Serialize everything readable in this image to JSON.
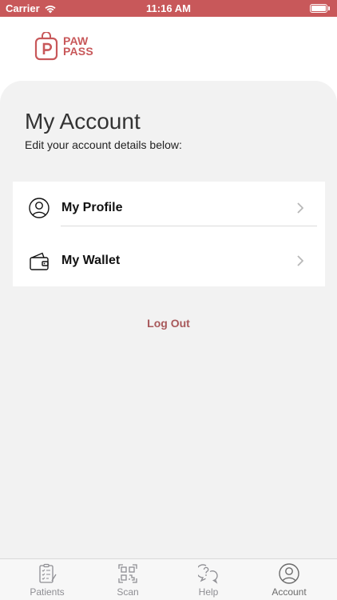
{
  "status_bar": {
    "carrier": "Carrier",
    "time": "11:16 AM"
  },
  "logo": {
    "line1": "PAW",
    "line2": "PASS",
    "brand_color": "#c8585a"
  },
  "page": {
    "title": "My Account",
    "subtitle": "Edit your account details below:"
  },
  "menu": {
    "items": [
      {
        "label": "My Profile",
        "icon": "user-circle-icon"
      },
      {
        "label": "My Wallet",
        "icon": "wallet-icon"
      }
    ]
  },
  "actions": {
    "logout_label": "Log Out",
    "logout_color": "#a8585a"
  },
  "tab_bar": {
    "tabs": [
      {
        "label": "Patients",
        "icon": "clipboard-icon",
        "active": false
      },
      {
        "label": "Scan",
        "icon": "qr-code-icon",
        "active": false
      },
      {
        "label": "Help",
        "icon": "help-chat-icon",
        "active": false
      },
      {
        "label": "Account",
        "icon": "user-circle-icon",
        "active": true
      }
    ]
  }
}
